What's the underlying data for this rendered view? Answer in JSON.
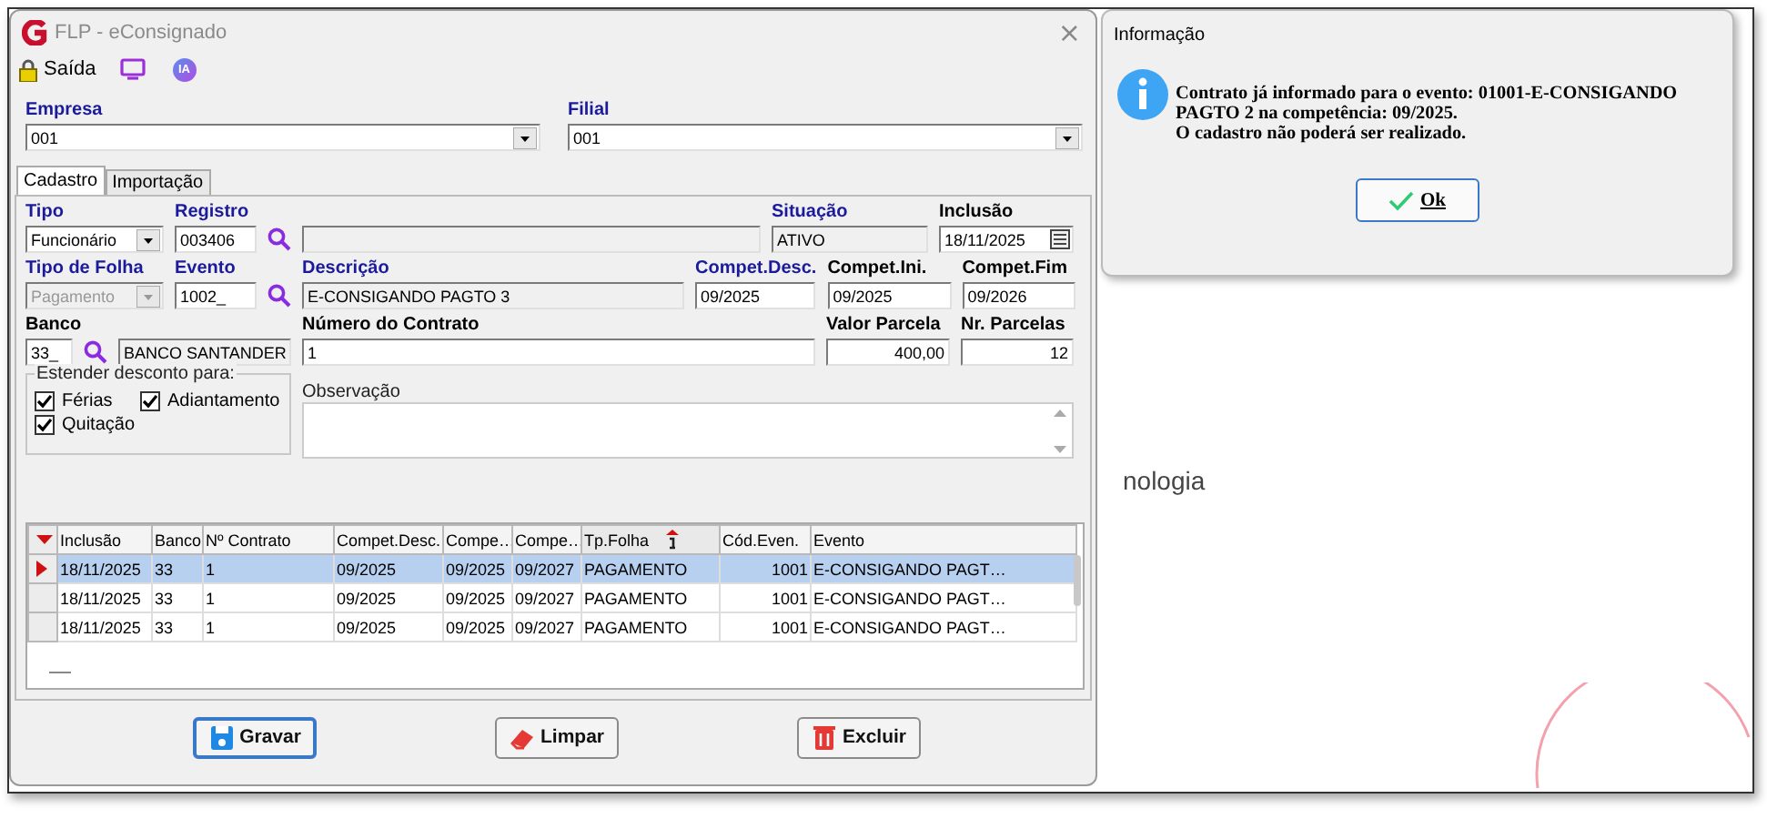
{
  "window": {
    "title": "FLP - eConsignado",
    "close": "×"
  },
  "toolbar": {
    "exit_label": "Saída",
    "ai_badge": "IA"
  },
  "company": [
    {
      "label": "Empresa",
      "value": "001",
      "required": true
    },
    {
      "label": "Filial",
      "value": "001",
      "required": true
    }
  ],
  "tabs": [
    {
      "label": "Cadastro",
      "selected": true
    },
    {
      "label": "Importação",
      "selected": false
    }
  ],
  "form_rows": [
    [
      {
        "label": "Tipo",
        "value": "Funcionário",
        "kind": "select",
        "required": true,
        "readonly": false,
        "disabled": false,
        "lookup": false
      },
      {
        "label": "Registro",
        "value": "003406",
        "kind": "text",
        "required": true,
        "readonly": false,
        "disabled": false,
        "lookup": true
      },
      {
        "kind": "text",
        "readonly": true,
        "disabled": false,
        "lookup": false
      },
      {
        "label": "Situação",
        "value": "ATIVO",
        "kind": "text",
        "required": true,
        "readonly": true,
        "disabled": false,
        "lookup": false
      },
      {
        "label": "Inclusão",
        "value": "18/11/2025",
        "kind": "date",
        "required": false,
        "readonly": false,
        "disabled": false,
        "lookup": false
      }
    ],
    [
      {
        "label": "Tipo de Folha",
        "value": "Pagamento",
        "kind": "select",
        "required": true,
        "readonly": false,
        "disabled": true,
        "lookup": false
      },
      {
        "label": "Evento",
        "value": "1002_",
        "kind": "text",
        "required": true,
        "readonly": false,
        "disabled": false,
        "lookup": true
      },
      {
        "label": "Descrição",
        "value": "E-CONSIGANDO PAGTO 3",
        "kind": "text",
        "required": true,
        "readonly": true,
        "disabled": false,
        "lookup": false
      },
      {
        "label": "Compet.Desc.",
        "value": "09/2025",
        "kind": "text",
        "required": true,
        "readonly": false,
        "disabled": false,
        "lookup": false
      },
      {
        "label": "Compet.Ini.",
        "value": "09/2025",
        "kind": "text",
        "required": false,
        "readonly": false,
        "disabled": false,
        "lookup": false
      },
      {
        "label": "Compet.Fim",
        "value": "09/2026",
        "kind": "text",
        "required": false,
        "readonly": false,
        "disabled": false,
        "lookup": false
      }
    ],
    [
      {
        "label": "Banco",
        "value": "33_",
        "kind": "text",
        "required": false,
        "readonly": false,
        "disabled": false,
        "lookup": true
      },
      {
        "value": "BANCO SANTANDER",
        "kind": "text",
        "readonly": true,
        "disabled": false,
        "lookup": false
      },
      {
        "label": "Número do Contrato",
        "value": "1",
        "kind": "text",
        "required": false,
        "readonly": false,
        "disabled": false,
        "lookup": false
      },
      {
        "label": "Valor Parcela",
        "value": "400,00",
        "kind": "number",
        "required": false,
        "readonly": false,
        "disabled": false,
        "lookup": false
      },
      {
        "label": "Nr. Parcelas",
        "value": "12",
        "kind": "number",
        "required": false,
        "readonly": false,
        "disabled": false,
        "lookup": false
      }
    ]
  ],
  "discount_group": {
    "title": "Estender desconto para:",
    "options": [
      {
        "label": "Férias",
        "checked": true
      },
      {
        "label": "Adiantamento",
        "checked": true
      },
      {
        "label": "Quitação",
        "checked": true
      }
    ]
  },
  "notes": {
    "label": "Observação"
  },
  "table": {
    "columns": [
      {
        "label": "Inclusão",
        "sorted": false
      },
      {
        "label": "Banco",
        "sorted": false
      },
      {
        "label": "Nº Contrato",
        "sorted": false
      },
      {
        "label": "Compet.Desc.",
        "sorted": false
      },
      {
        "label": "Compe…",
        "sorted": false
      },
      {
        "label": "Compe…",
        "sorted": false
      },
      {
        "label": "Tp.Folha",
        "sorted": true
      },
      {
        "label": "Cód.Even.",
        "sorted": false
      },
      {
        "label": "Evento",
        "sorted": false
      }
    ],
    "rows": [
      {
        "selected": true,
        "cells": [
          "18/11/2025",
          "33",
          "1",
          "09/2025",
          "09/2025",
          "09/2027",
          "PAGAMENTO",
          "1001",
          "E-CONSIGANDO PAGT…"
        ]
      },
      {
        "selected": false,
        "cells": [
          "18/11/2025",
          "33",
          "1",
          "09/2025",
          "09/2025",
          "09/2027",
          "PAGAMENTO",
          "1001",
          "E-CONSIGANDO PAGT…"
        ]
      },
      {
        "selected": false,
        "cells": [
          "18/11/2025",
          "33",
          "1",
          "09/2025",
          "09/2025",
          "09/2027",
          "PAGAMENTO",
          "1001",
          "E-CONSIGANDO PAGT…"
        ]
      }
    ]
  },
  "buttons": [
    {
      "label": "Gravar",
      "kind": "save",
      "focused": true
    },
    {
      "label": "Limpar",
      "kind": "clear",
      "focused": false
    },
    {
      "label": "Excluir",
      "kind": "delete",
      "focused": false
    }
  ],
  "dialog": {
    "title": "Informação",
    "lines": [
      "Contrato já informado para o evento: 01001-E-CONSIGANDO",
      "PAGTO 2 na competência: 09/2025.",
      "O cadastro não poderá ser realizado."
    ],
    "ok_label": "Ok"
  },
  "background_text": "nologia"
}
